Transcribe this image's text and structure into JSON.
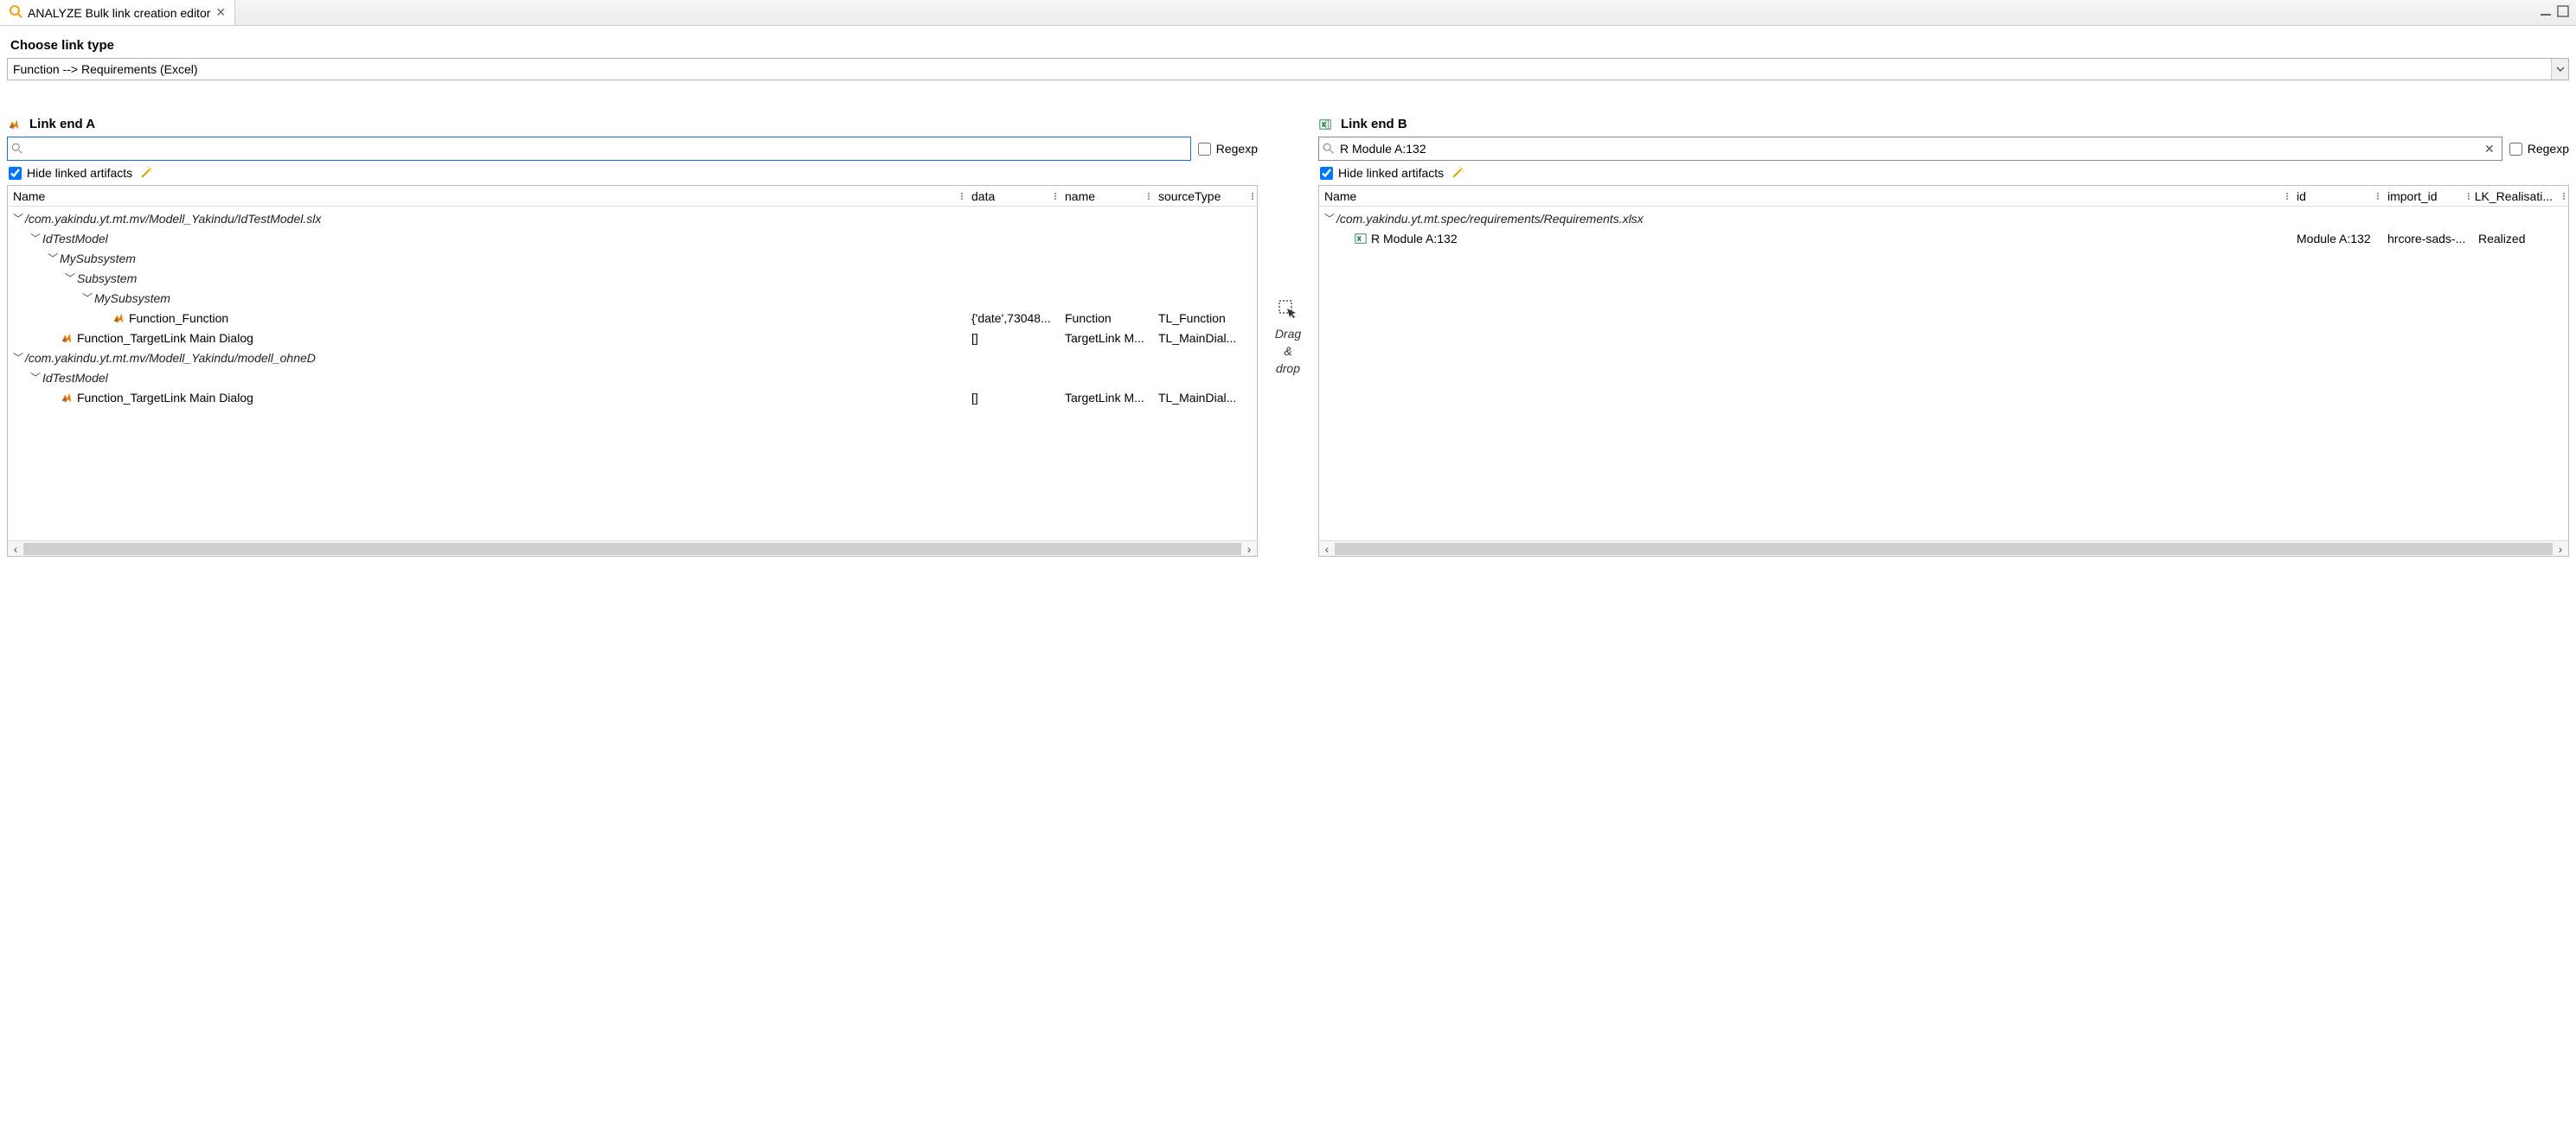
{
  "titlebar": {
    "tab_title": "ANALYZE Bulk link creation editor"
  },
  "linktype": {
    "label": "Choose link type",
    "value": "Function --> Requirements (Excel)"
  },
  "center": {
    "l1": "Drag",
    "l2": "&",
    "l3": "drop"
  },
  "paneA": {
    "title": "Link end A",
    "search_value": "",
    "regexp_label": "Regexp",
    "regexp_checked": false,
    "hide_label": "Hide linked artifacts",
    "hide_checked": true,
    "columns": [
      "Name",
      "data",
      "name",
      "sourceType"
    ],
    "rows": [
      {
        "d": 0,
        "tw": true,
        "it": true,
        "icon": "",
        "c": [
          "/com.yakindu.yt.mt.mv/Modell_Yakindu/IdTestModel.slx",
          "",
          "",
          ""
        ]
      },
      {
        "d": 1,
        "tw": true,
        "it": true,
        "icon": "",
        "c": [
          "IdTestModel",
          "",
          "",
          ""
        ]
      },
      {
        "d": 2,
        "tw": true,
        "it": true,
        "icon": "",
        "c": [
          "MySubsystem",
          "",
          "",
          ""
        ]
      },
      {
        "d": 3,
        "tw": true,
        "it": true,
        "icon": "",
        "c": [
          "Subsystem",
          "",
          "",
          ""
        ]
      },
      {
        "d": 4,
        "tw": true,
        "it": true,
        "icon": "",
        "c": [
          "MySubsystem",
          "",
          "",
          ""
        ]
      },
      {
        "d": 5,
        "tw": false,
        "it": false,
        "icon": "matlab",
        "c": [
          "Function_Function",
          "{'date',73048...",
          "Function",
          "TL_Function"
        ]
      },
      {
        "d": 2,
        "tw": false,
        "it": false,
        "icon": "matlab",
        "c": [
          "Function_TargetLink Main Dialog",
          "[]",
          "TargetLink M...",
          "TL_MainDial..."
        ]
      },
      {
        "d": 0,
        "tw": true,
        "it": true,
        "icon": "",
        "c": [
          "/com.yakindu.yt.mt.mv/Modell_Yakindu/modell_ohneD",
          "",
          "",
          ""
        ]
      },
      {
        "d": 1,
        "tw": true,
        "it": true,
        "icon": "",
        "c": [
          "IdTestModel",
          "",
          "",
          ""
        ]
      },
      {
        "d": 2,
        "tw": false,
        "it": false,
        "icon": "matlab",
        "c": [
          "Function_TargetLink Main Dialog",
          "[]",
          "TargetLink M...",
          "TL_MainDial..."
        ]
      }
    ]
  },
  "paneB": {
    "title": "Link end B",
    "search_value": "R Module A:132",
    "regexp_label": "Regexp",
    "regexp_checked": false,
    "hide_label": "Hide linked artifacts",
    "hide_checked": true,
    "columns": [
      "Name",
      "id",
      "import_id",
      "LK_Realisati..."
    ],
    "rows": [
      {
        "d": 0,
        "tw": true,
        "it": true,
        "icon": "",
        "c": [
          "/com.yakindu.yt.mt.spec/requirements/Requirements.xlsx",
          "",
          "",
          ""
        ]
      },
      {
        "d": 1,
        "tw": false,
        "it": false,
        "icon": "excel",
        "c": [
          "R Module A:132",
          "Module A:132",
          "hrcore-sads-...",
          "Realized"
        ]
      }
    ]
  }
}
